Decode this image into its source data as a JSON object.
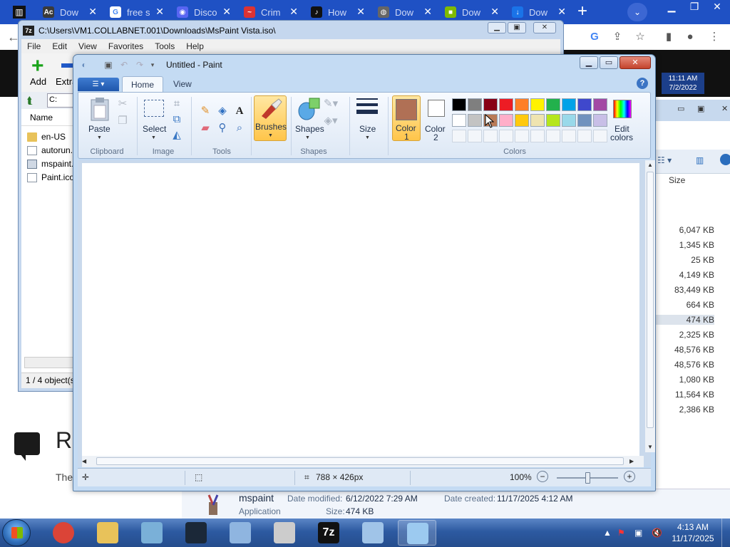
{
  "browser": {
    "tabs": [
      {
        "label": "Dow",
        "icon": "ac-icon",
        "color": "#3a3a3a",
        "glyph": "Ac"
      },
      {
        "label": "free s",
        "icon": "google-icon",
        "color": "#ffffff",
        "glyph": "G"
      },
      {
        "label": "Disco",
        "icon": "discord-icon",
        "color": "#5865f2",
        "glyph": "◉"
      },
      {
        "label": "Crim",
        "icon": "crim-icon",
        "color": "#d33",
        "glyph": "~"
      },
      {
        "label": "How",
        "icon": "tiktok-icon",
        "color": "#111",
        "glyph": "♪"
      },
      {
        "label": "Dow",
        "icon": "globe-icon",
        "color": "#666",
        "glyph": "◍"
      },
      {
        "label": "Dow",
        "icon": "microsoft-icon",
        "color": "#7fba00",
        "glyph": "■"
      },
      {
        "label": "Dow",
        "icon": "download-icon",
        "color": "#1a73e8",
        "glyph": "↓"
      }
    ],
    "new_tab": "+",
    "tab_search": "⌄",
    "clock_time": "11:11 AM",
    "clock_date": "7/2/2022"
  },
  "page": {
    "heading": "R",
    "text": "The"
  },
  "sevenzip": {
    "title": "C:\\Users\\VM1.COLLABNET.001\\Downloads\\MsPaint Vista.iso\\",
    "icon": "7z",
    "menu": [
      "File",
      "Edit",
      "View",
      "Favorites",
      "Tools",
      "Help"
    ],
    "add_label": "Add",
    "extract_label": "Extra",
    "path": "C:",
    "col_name": "Name",
    "files": [
      {
        "name": "en-US",
        "type": "folder"
      },
      {
        "name": "autorun.",
        "type": "file"
      },
      {
        "name": "mspaint.",
        "type": "exe"
      },
      {
        "name": "Paint.ico",
        "type": "file"
      }
    ],
    "status": "1 / 4 object(s"
  },
  "explorer_right": {
    "size_header": "Size",
    "sizes": [
      "6,047 KB",
      "1,345 KB",
      "25 KB",
      "4,149 KB",
      "83,449 KB",
      "664 KB",
      "474 KB",
      "2,325 KB",
      "48,576 KB",
      "48,576 KB",
      "1,080 KB",
      "11,564 KB",
      "2,386 KB"
    ],
    "selected_index": 6
  },
  "details": {
    "name": "mspaint",
    "type": "Application",
    "modified_label": "Date modified:",
    "modified_value": "6/12/2022 7:29 AM",
    "created_label": "Date created:",
    "created_value": "11/17/2025 4:12 AM",
    "size_label": "Size:",
    "size_value": "474 KB"
  },
  "paint": {
    "title": "Untitled - Paint",
    "tabs": {
      "home": "Home",
      "view": "View"
    },
    "help": "?",
    "groups": {
      "clipboard": "Clipboard",
      "image": "Image",
      "tools": "Tools",
      "shapes": "Shapes",
      "colors": "Colors"
    },
    "buttons": {
      "paste": "Paste",
      "select": "Select",
      "brushes": "Brushes",
      "shapes": "Shapes",
      "size": "Size",
      "color1_line1": "Color",
      "color1_line2": "1",
      "color2_line1": "Color",
      "color2_line2": "2",
      "edit_colors_line1": "Edit",
      "edit_colors_line2": "colors"
    },
    "color1": "#b07055",
    "color2": "#ffffff",
    "palette_row1": [
      "#000000",
      "#7f7f7f",
      "#880015",
      "#ed1c24",
      "#ff7f27",
      "#fff200",
      "#22b14c",
      "#00a2e8",
      "#3f48cc",
      "#a349a4"
    ],
    "palette_row2": [
      "#ffffff",
      "#c3c3c3",
      "#b97a57",
      "#ffaec9",
      "#ffc90e",
      "#efe4b0",
      "#b5e61d",
      "#99d9ea",
      "#7092be",
      "#c8bfe7"
    ],
    "status": {
      "dimensions": "788 × 426px",
      "zoom": "100%",
      "zoom_minus": "−",
      "zoom_plus": "+"
    }
  },
  "taskbar": {
    "time": "4:13 AM",
    "date": "11/17/2025",
    "items": [
      {
        "name": "chrome",
        "color": "#db4437"
      },
      {
        "name": "explorer",
        "color": "#e8c25a"
      },
      {
        "name": "paint-old",
        "color": "#7ab0d8"
      },
      {
        "name": "steam",
        "color": "#1b2838"
      },
      {
        "name": "keyboard",
        "color": "#8fb5e0"
      },
      {
        "name": "disc",
        "color": "#cccccc"
      },
      {
        "name": "7zip",
        "color": "#111111",
        "label": "7z"
      },
      {
        "name": "paint-brushes",
        "color": "#a0c4e8"
      },
      {
        "name": "paint-active",
        "color": "#9ccaf0"
      }
    ]
  }
}
